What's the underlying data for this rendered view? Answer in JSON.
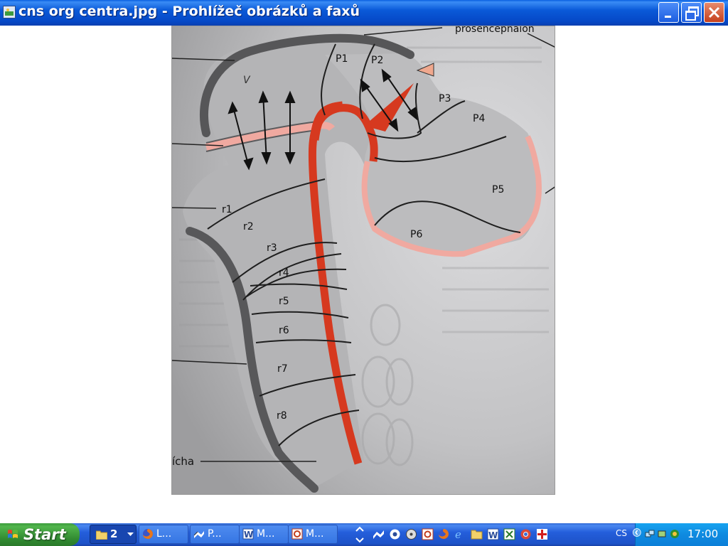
{
  "window": {
    "title": "cns org centra.jpg - Prohlížeč obrázků a faxů"
  },
  "image": {
    "labels": {
      "prosencephalon": "prosencephalon",
      "v": "V",
      "p1": "P1",
      "p2": "P2",
      "p3": "P3",
      "p4": "P4",
      "p5": "P5",
      "p6": "P6",
      "r1": "r1",
      "r2": "r2",
      "r3": "r3",
      "r4": "r4",
      "r5": "r5",
      "r6": "r6",
      "r7": "r7",
      "r8": "r8",
      "cha": "ícha"
    }
  },
  "viewer_toolbar": {
    "icons": [
      "previous-image-icon",
      "next-image-icon",
      "best-fit-icon",
      "actual-size-icon",
      "slideshow-icon",
      "zoom-in-icon",
      "zoom-out-icon",
      "rotate-clockwise-icon",
      "rotate-counterclockwise-icon",
      "delete-icon",
      "print-icon",
      "save-icon",
      "edit-icon",
      "help-icon"
    ]
  },
  "taskbar": {
    "start_label": "Start",
    "group_count": "2",
    "tasks": [
      {
        "label": "L...",
        "icon": "firefox-icon"
      },
      {
        "label": "P...",
        "icon": "image-viewer-icon"
      },
      {
        "label": "M...",
        "icon": "word-icon"
      },
      {
        "label": "M...",
        "icon": "office-icon"
      }
    ],
    "language": "CS",
    "clock": "17:00"
  },
  "colors": {
    "titlebar": "#0a59d8",
    "taskbar": "#245edb",
    "start": "#3c9c3c",
    "tray": "#0f8ae0",
    "vessel_red": "#d83a24",
    "membrane_pink": "#f0a9a0",
    "wall_dark": "#5c5c5c",
    "tissue_grey": "#b3b3b3"
  }
}
